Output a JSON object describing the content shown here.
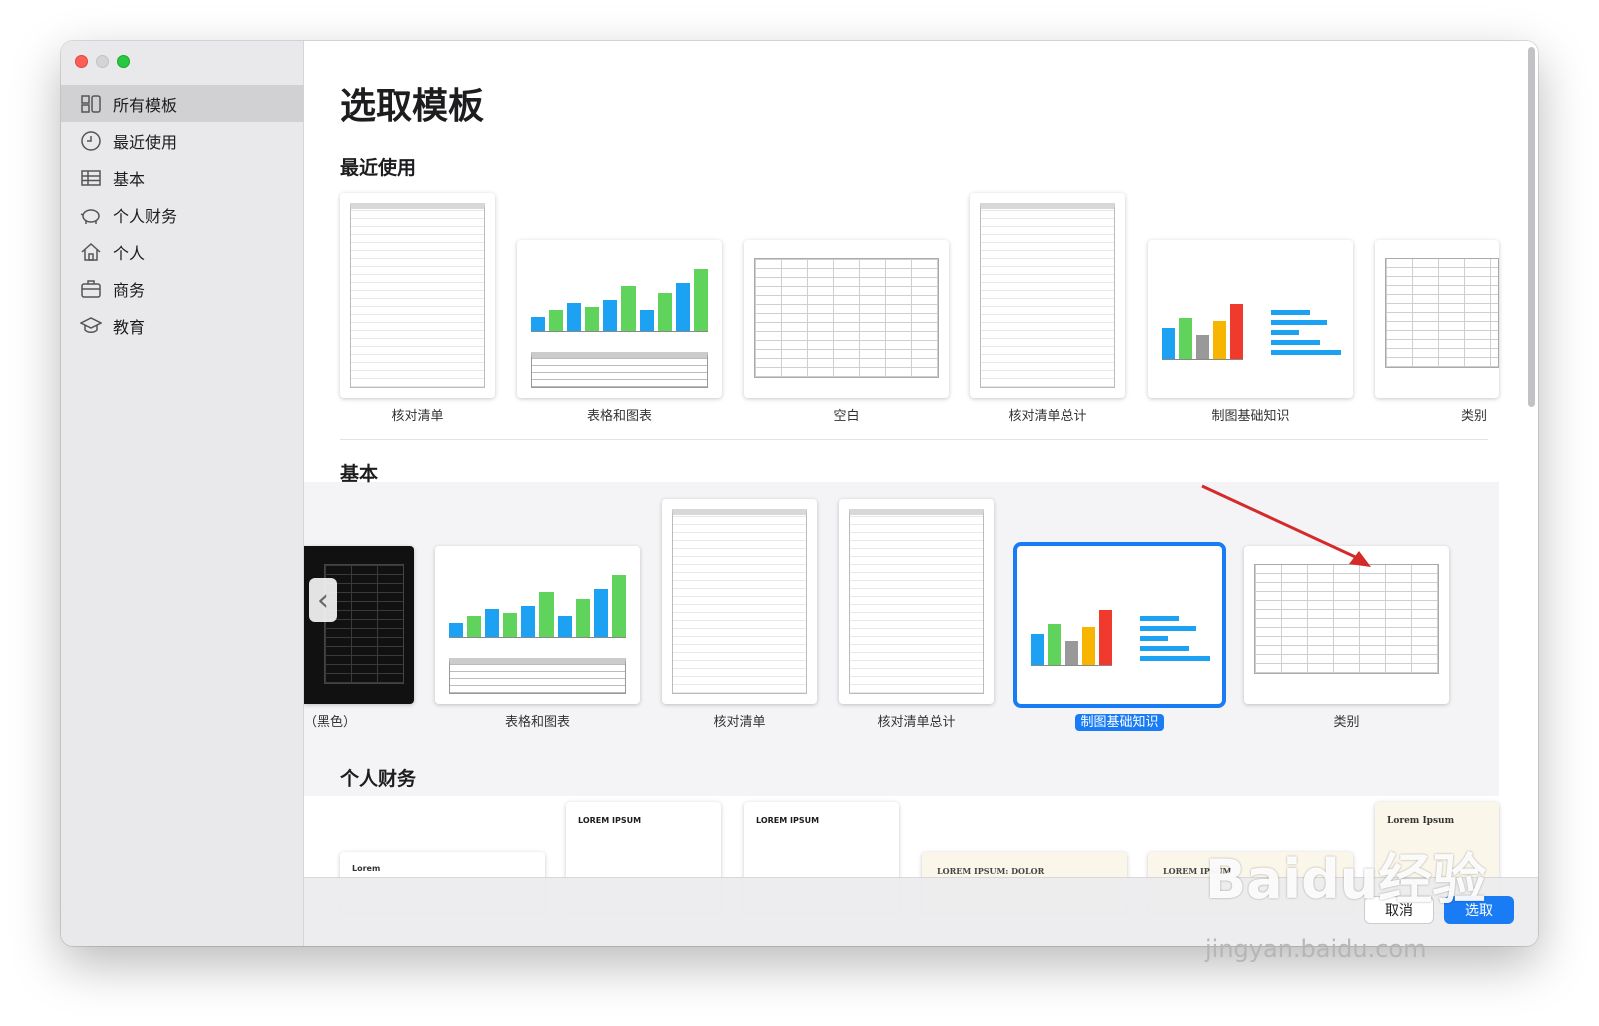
{
  "sidebar": {
    "items": [
      {
        "label": "所有模板",
        "icon": "all-templates-icon",
        "active": true
      },
      {
        "label": "最近使用",
        "icon": "clock-icon",
        "active": false
      },
      {
        "label": "基本",
        "icon": "table-icon",
        "active": false
      },
      {
        "label": "个人财务",
        "icon": "piggy-bank-icon",
        "active": false
      },
      {
        "label": "个人",
        "icon": "house-icon",
        "active": false
      },
      {
        "label": "商务",
        "icon": "briefcase-icon",
        "active": false
      },
      {
        "label": "教育",
        "icon": "graduation-cap-icon",
        "active": false
      }
    ]
  },
  "main": {
    "title": "选取模板",
    "sections": [
      {
        "title": "最近使用",
        "templates": [
          "核对清单",
          "表格和图表",
          "空白",
          "核对清单总计",
          "制图基础知识",
          "类别"
        ]
      },
      {
        "title": "基本",
        "templates": [
          "（黑色）",
          "表格和图表",
          "核对清单",
          "核对清单总计",
          "制图基础知识",
          "类别"
        ],
        "selected": "制图基础知识"
      },
      {
        "title": "个人财务",
        "templates": [
          "Lorem",
          "LOREM IPSUM",
          "LOREM IPSUM",
          "LOREM IPSUM: DOLOR",
          "LOREM IPSUM",
          "Lorem Ipsum"
        ]
      }
    ]
  },
  "footer": {
    "cancel_label": "取消",
    "select_label": "选取"
  },
  "watermark": {
    "brand": "Baidu经验",
    "url": "jingyan.baidu.com"
  },
  "colors": {
    "accent": "#1a7cf5",
    "arrow": "#d42a2a",
    "bar_blue": "#1da1f2",
    "bar_green": "#5fd35b"
  }
}
